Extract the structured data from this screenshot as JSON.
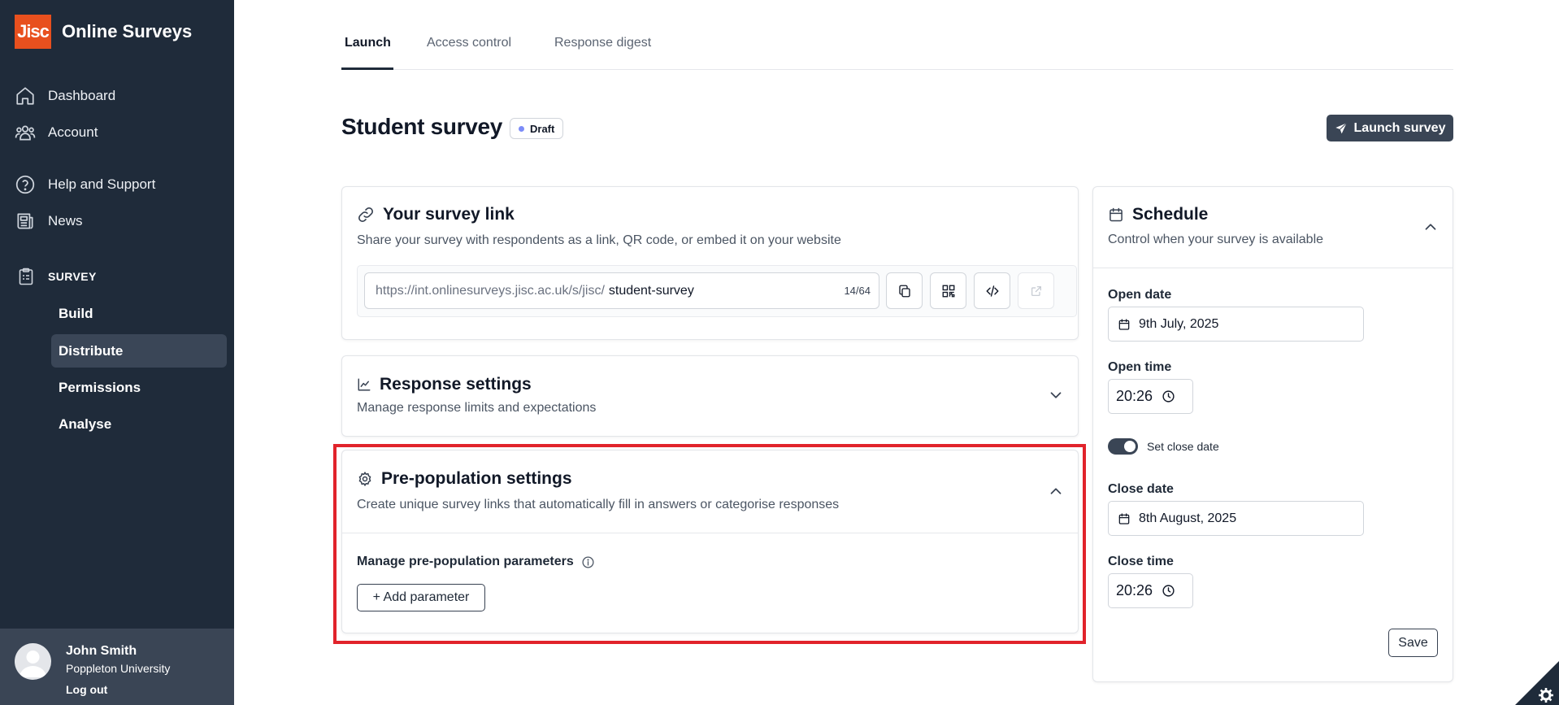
{
  "app": {
    "logo_text": "Jisc",
    "name": "Online Surveys"
  },
  "sidebar": {
    "nav": [
      {
        "label": "Dashboard",
        "icon": "home-icon"
      },
      {
        "label": "Account",
        "icon": "users-icon"
      },
      {
        "label": "Help and Support",
        "icon": "help-circle-icon"
      },
      {
        "label": "News",
        "icon": "newspaper-icon"
      }
    ],
    "section": {
      "label": "SURVEY",
      "icon": "clipboard-icon"
    },
    "sub_items": [
      {
        "label": "Build",
        "active": false
      },
      {
        "label": "Distribute",
        "active": true
      },
      {
        "label": "Permissions",
        "active": false
      },
      {
        "label": "Analyse",
        "active": false
      }
    ],
    "user": {
      "name": "John Smith",
      "org": "Poppleton University",
      "logout": "Log out"
    }
  },
  "tabs": [
    {
      "label": "Launch",
      "active": true
    },
    {
      "label": "Access control",
      "active": false
    },
    {
      "label": "Response digest",
      "active": false
    }
  ],
  "header": {
    "title": "Student survey",
    "badge": "Draft",
    "launch_button": "Launch survey"
  },
  "survey_link": {
    "title": "Your survey link",
    "description": "Share your survey with respondents as a link, QR code, or embed it on your website",
    "url_prefix": "https://int.onlinesurveys.jisc.ac.uk/s/jisc/",
    "url_slug": "student-survey",
    "char_count": "14/64",
    "buttons": [
      "copy-icon",
      "qr-code-icon",
      "code-icon",
      "external-link-icon"
    ]
  },
  "response_settings": {
    "title": "Response settings",
    "description": "Manage response limits and expectations"
  },
  "prepopulation": {
    "title": "Pre-population settings",
    "description": "Create unique survey links that automatically fill in answers or categorise responses",
    "manage_label": "Manage pre-population parameters",
    "add_button": "+ Add parameter"
  },
  "schedule": {
    "title": "Schedule",
    "description": "Control when your survey is available",
    "open_date_label": "Open date",
    "open_date": "9th July, 2025",
    "open_time_label": "Open time",
    "open_time": "20:26",
    "toggle_label": "Set close date",
    "toggle_on": true,
    "close_date_label": "Close date",
    "close_date": "8th August, 2025",
    "close_time_label": "Close time",
    "close_time": "20:26",
    "save_button": "Save"
  },
  "colors": {
    "sidebar": "#1f2b3a",
    "brand": "#e8501e",
    "accent": "#3a4555",
    "highlight": "#e1232b"
  }
}
